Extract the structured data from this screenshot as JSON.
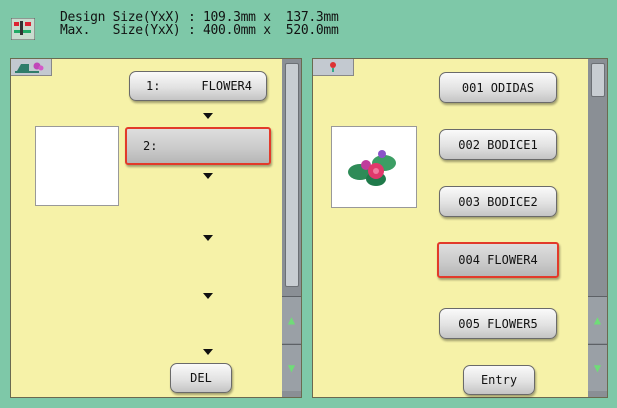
{
  "header": {
    "line1": "Design Size(YxX) : 109.3mm x  137.3mm",
    "line2": "Max.   Size(YxX) : 400.0mm x  520.0mm",
    "icon": "design-size-icon"
  },
  "left_panel": {
    "tab_icon": "sewing-machine-icon",
    "slots": [
      {
        "number": "1:",
        "name": "FLOWER4"
      },
      {
        "number": "2:",
        "name": ""
      }
    ],
    "delete_label": "DEL",
    "selected_slot": 2
  },
  "right_panel": {
    "tab_icon": "flower-icon",
    "designs": [
      "001 ODIDAS",
      "002 BODICE1",
      "003 BODICE2",
      "004 FLOWER4",
      "005 FLOWER5"
    ],
    "selected_design": "004 FLOWER4",
    "entry_label": "Entry"
  },
  "colors": {
    "background": "#7ec8a8",
    "panel": "#f6f2a8",
    "selection": "#e23a2a",
    "scroll_arrow": "#6fdc78"
  }
}
